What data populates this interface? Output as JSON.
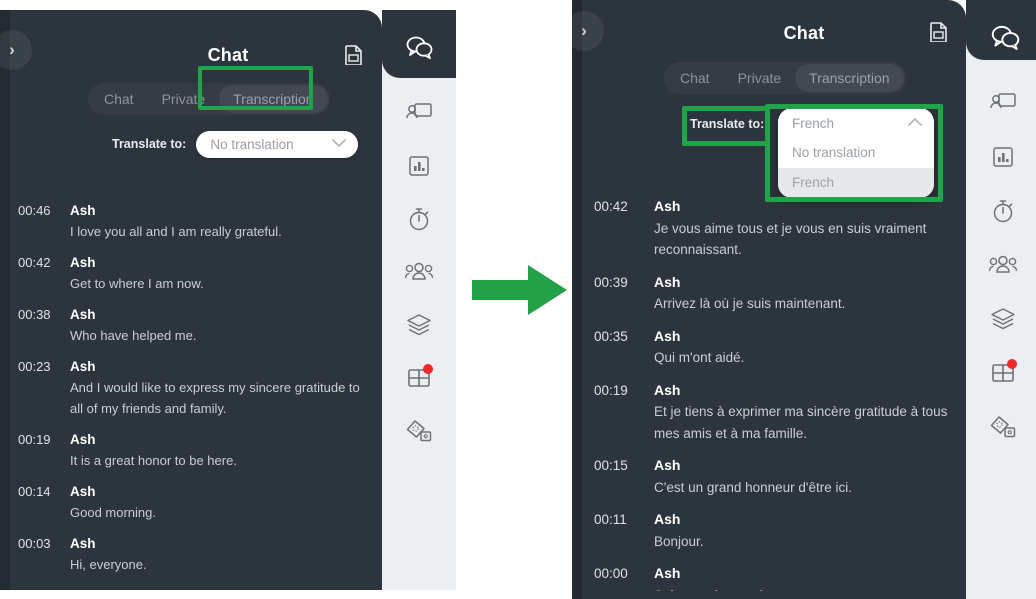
{
  "panels": {
    "left": {
      "header": {
        "title": "Chat",
        "doc_icon": "document-icon",
        "collapse_icon": "›"
      },
      "tabs": [
        {
          "label": "Chat",
          "active": false
        },
        {
          "label": "Private",
          "active": false
        },
        {
          "label": "Transcription",
          "active": true
        }
      ],
      "translate": {
        "label": "Translate to:",
        "value": "No translation",
        "chevron": "⌄",
        "open": false
      },
      "transcript": [
        {
          "time": "00:46",
          "name": "Ash",
          "text": "I love you all and I am really grateful."
        },
        {
          "time": "00:42",
          "name": "Ash",
          "text": "Get to where I am now."
        },
        {
          "time": "00:38",
          "name": "Ash",
          "text": "Who have helped me."
        },
        {
          "time": "00:23",
          "name": "Ash",
          "text": "And I would like to express my sincere gratitude to all of my friends and family."
        },
        {
          "time": "00:19",
          "name": "Ash",
          "text": "It is a great honor to be here."
        },
        {
          "time": "00:14",
          "name": "Ash",
          "text": "Good morning."
        },
        {
          "time": "00:03",
          "name": "Ash",
          "text": "Hi, everyone."
        }
      ]
    },
    "right": {
      "header": {
        "title": "Chat",
        "doc_icon": "document-icon",
        "collapse_icon": "›"
      },
      "tabs": [
        {
          "label": "Chat",
          "active": false
        },
        {
          "label": "Private",
          "active": false
        },
        {
          "label": "Transcription",
          "active": true
        }
      ],
      "translate": {
        "label": "Translate to:",
        "value": "French",
        "chevron": "⌃",
        "open": true,
        "options": [
          {
            "label": "No translation",
            "selected": false
          },
          {
            "label": "French",
            "selected": true
          }
        ]
      },
      "transcript": [
        {
          "time": "00:42",
          "name": "Ash",
          "text": "Je vous aime tous et je vous en suis vraiment reconnaissant."
        },
        {
          "time": "00:39",
          "name": "Ash",
          "text": "Arrivez là où je suis maintenant."
        },
        {
          "time": "00:35",
          "name": "Ash",
          "text": "Qui m'ont aidé."
        },
        {
          "time": "00:19",
          "name": "Ash",
          "text": "Et je tiens à exprimer ma sincère gratitude à tous mes amis et à ma famille."
        },
        {
          "time": "00:15",
          "name": "Ash",
          "text": "C'est un grand honneur d'être ici."
        },
        {
          "time": "00:11",
          "name": "Ash",
          "text": "Bonjour."
        },
        {
          "time": "00:00",
          "name": "Ash",
          "text": "Salut tout le monde."
        }
      ]
    }
  },
  "rail": {
    "active_icon": "chat-bubbles-icon",
    "items": [
      {
        "icon": "screen-share-icon",
        "badge": false
      },
      {
        "icon": "poll-chart-icon",
        "badge": false
      },
      {
        "icon": "timer-icon",
        "badge": false
      },
      {
        "icon": "participants-icon",
        "badge": false
      },
      {
        "icon": "layers-icon",
        "badge": false
      },
      {
        "icon": "breakout-rooms-icon",
        "badge": true
      },
      {
        "icon": "whiteboard-shapes-icon",
        "badge": false
      }
    ]
  },
  "annotations": {
    "arrow_icon": "right-arrow-annotation",
    "accent_color": "#22a34a",
    "highlights": [
      "left-transcription-tab",
      "right-translate-label",
      "right-translate-dropdown"
    ]
  }
}
